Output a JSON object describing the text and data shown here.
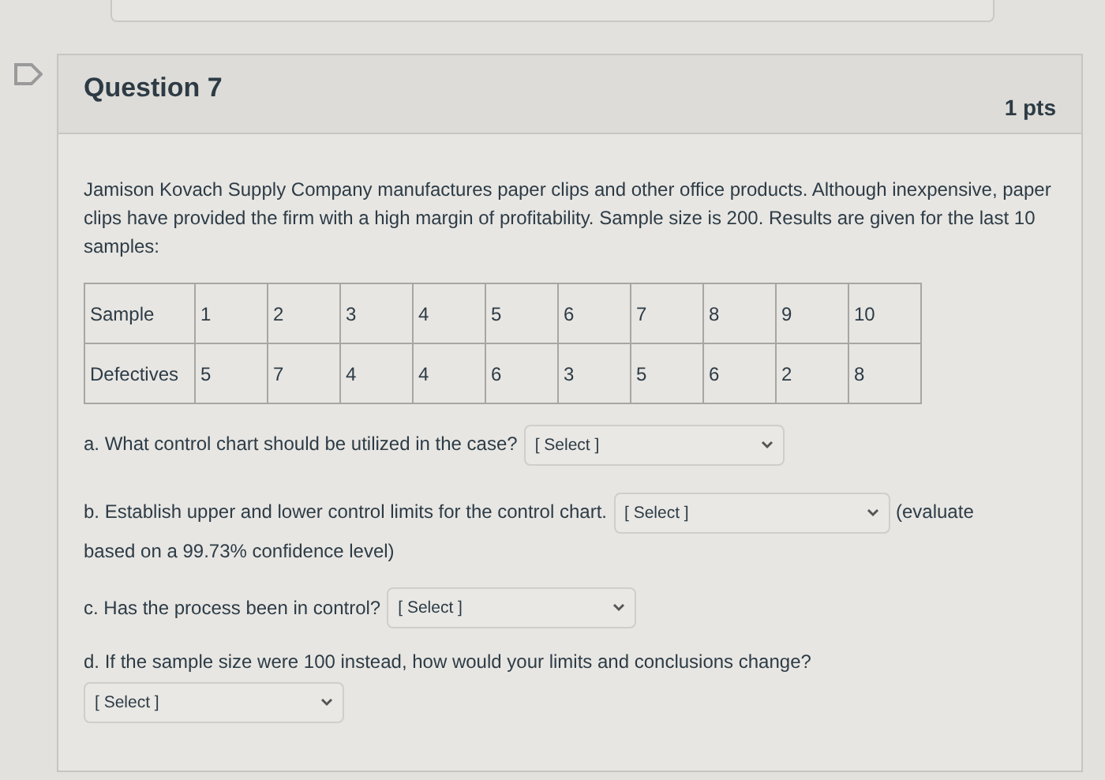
{
  "question": {
    "title": "Question 7",
    "points": "1 pts",
    "intro": "Jamison Kovach Supply Company manufactures paper clips and other office products. Although inexpensive, paper clips have provided the firm with a high margin of profitability. Sample size is 200. Results are given for the last 10 samples:",
    "table": {
      "rows": [
        [
          "Sample",
          "1",
          "2",
          "3",
          "4",
          "5",
          "6",
          "7",
          "8",
          "9",
          "10"
        ],
        [
          "Defectives",
          "5",
          "7",
          "4",
          "4",
          "6",
          "3",
          "5",
          "6",
          "2",
          "8"
        ]
      ]
    },
    "parts": [
      {
        "kind": "inline",
        "prompt": "a. What control chart should be utilized in the case?",
        "select": "[ Select ]"
      },
      {
        "kind": "inline",
        "prompt": "b. Establish upper and lower control limits for the control chart.",
        "select": "[ Select ]",
        "suffix": "(evaluate",
        "continuation": "based on a 99.73% confidence level)"
      },
      {
        "kind": "inline",
        "prompt": "c. Has the process been in control?",
        "select": "[ Select ]"
      },
      {
        "kind": "below",
        "prompt": "d. If the sample size were 100 instead, how would your limits and conclusions change?",
        "select": "[ Select ]"
      }
    ]
  }
}
